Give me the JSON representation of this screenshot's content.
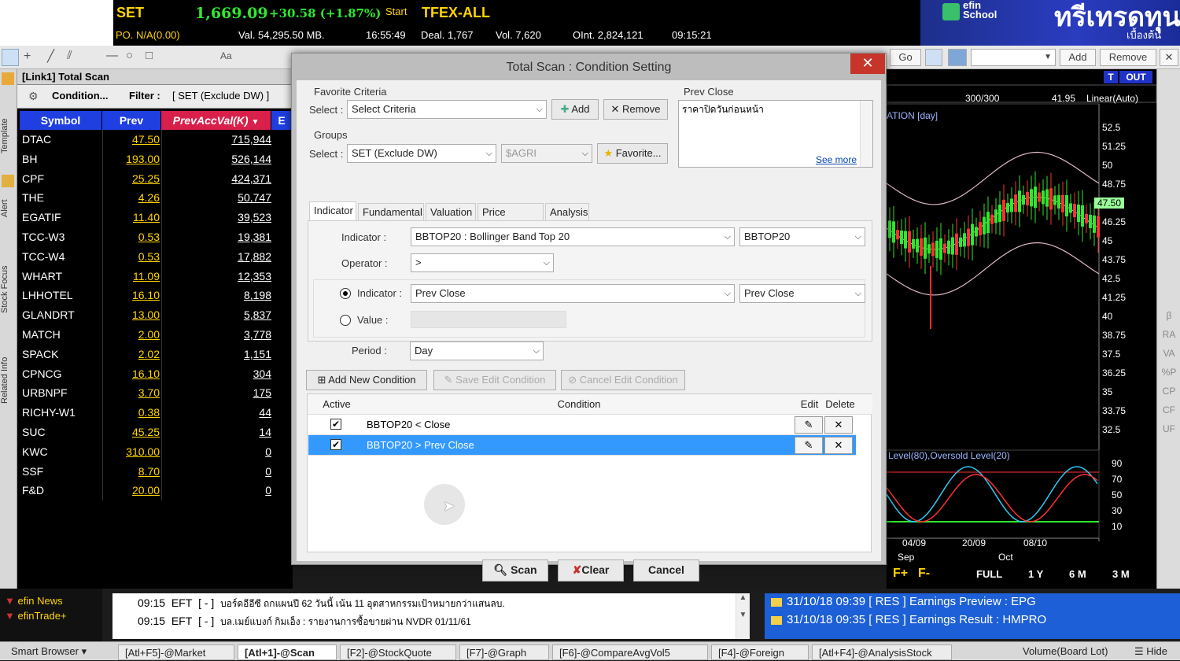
{
  "ticker": {
    "set_label": "SET",
    "set_value": "1,669.09",
    "set_change": "+30.58 (+1.87%)",
    "start_label": "Start",
    "tfex_label": "TFEX-ALL",
    "po_label": "PO. N/A(0.00)",
    "val_label": "Val. 54,295.50 MB.",
    "time1": "16:55:49",
    "deal_label": "Deal. 1,767",
    "vol_label": "Vol. 7,620",
    "oint_label": "OInt. 2,824,121",
    "time2": "09:15:21"
  },
  "banner": {
    "efin_label": "efin School",
    "title": "ทรีเทรดทุน",
    "subtitle": "เบื้องต้น"
  },
  "toolbar": {
    "go_label": "Go",
    "add_label": "Add",
    "remove_label": "Remove"
  },
  "left_tabs": [
    "Template",
    "Alert",
    "Stock Focus",
    "Related Info"
  ],
  "scan_panel": {
    "title": "[Link1] Total Scan",
    "condition_label": "Condition...",
    "filter_label": "Filter :",
    "filter_value": "[ SET (Exclude DW) ]",
    "columns": [
      "Symbol",
      "Prev",
      "PrevAccVal(K)"
    ],
    "rows": [
      {
        "symbol": "DTAC",
        "prev": "47.50",
        "val": "715,944"
      },
      {
        "symbol": "BH",
        "prev": "193.00",
        "val": "526,144"
      },
      {
        "symbol": "CPF",
        "prev": "25.25",
        "val": "424,371"
      },
      {
        "symbol": "THE",
        "prev": "4.26",
        "val": "50,747"
      },
      {
        "symbol": "EGATIF",
        "prev": "11.40",
        "val": "39,523"
      },
      {
        "symbol": "TCC-W3",
        "prev": "0.53",
        "val": "19,381"
      },
      {
        "symbol": "TCC-W4",
        "prev": "0.53",
        "val": "17,882"
      },
      {
        "symbol": "WHART",
        "prev": "11.09",
        "val": "12,353"
      },
      {
        "symbol": "LHHOTEL",
        "prev": "16.10",
        "val": "8,198"
      },
      {
        "symbol": "GLANDRT",
        "prev": "13.00",
        "val": "5,837"
      },
      {
        "symbol": "MATCH",
        "prev": "2.00",
        "val": "3,778"
      },
      {
        "symbol": "SPACK",
        "prev": "2.02",
        "val": "1,151"
      },
      {
        "symbol": "CPNCG",
        "prev": "16.10",
        "val": "304"
      },
      {
        "symbol": "URBNPF",
        "prev": "3.70",
        "val": "175"
      },
      {
        "symbol": "RICHY-W1",
        "prev": "0.38",
        "val": "44"
      },
      {
        "symbol": "SUC",
        "prev": "45.25",
        "val": "14"
      },
      {
        "symbol": "KWC",
        "prev": "310.00",
        "val": "0"
      },
      {
        "symbol": "SSF",
        "prev": "8.70",
        "val": "0"
      },
      {
        "symbol": "F&D",
        "prev": "20.00",
        "val": "0"
      }
    ]
  },
  "dialog": {
    "title": "Total Scan : Condition Setting",
    "favorite_criteria_label": "Favorite Criteria",
    "select_label": "Select :",
    "select_criteria_value": "Select Criteria",
    "add_label": "Add",
    "remove_label": "Remove",
    "groups_label": "Groups",
    "group_value": "SET (Exclude DW)",
    "group_sub_value": "$AGRI",
    "favorite_label": "Favorite...",
    "prev_close_label": "Prev Close",
    "prev_close_text": "ราคาปิดวันก่อนหน้า",
    "see_more_label": "See more",
    "tabs": [
      "Indicator",
      "Fundamental",
      "Valuation",
      "Price Pattern",
      "Analysis"
    ],
    "indicator_label": "Indicator :",
    "indicator_value": "BBTOP20 : Bollinger Band  Top 20",
    "indicator_short": "BBTOP20",
    "operator_label": "Operator :",
    "operator_value": ">",
    "indicator2_label": "Indicator :",
    "indicator2_value": "Prev Close",
    "indicator2_short": "Prev Close",
    "value_label": "Value :",
    "period_label": "Period :",
    "period_value": "Day",
    "add_condition_label": "Add New Condition",
    "save_condition_label": "Save Edit Condition",
    "cancel_condition_label": "Cancel Edit Condition",
    "table_headers": {
      "active": "Active",
      "condition": "Condition",
      "edit": "Edit",
      "delete": "Delete"
    },
    "conditions": [
      {
        "text": "BBTOP20 < Close",
        "active": "✔"
      },
      {
        "text": "BBTOP20 > Prev Close",
        "active": "✔"
      }
    ],
    "scan_label": "Scan",
    "clear_label": "Clear",
    "cancel_label": "Cancel"
  },
  "chart": {
    "t_label": "T",
    "out_label": "OUT",
    "count_label": "300/300",
    "last_value": "41.95",
    "scale_label": "Linear(Auto)",
    "indicator_title": "ATION [day]",
    "price_ticks": [
      "52.5",
      "51.25",
      "50",
      "48.75",
      "47.50",
      "46.25",
      "45",
      "43.75",
      "42.5",
      "41.25",
      "40",
      "38.75",
      "37.5",
      "36.25",
      "35",
      "33.75",
      "32.5"
    ],
    "osc_title": "Level(80),Oversold Level(20)",
    "osc_ticks": [
      "90",
      "70",
      "50",
      "30",
      "10"
    ],
    "date_labels": [
      "04/09",
      "20/09",
      "08/10"
    ],
    "month_labels": [
      "Sep",
      "Oct"
    ],
    "period_buttons": [
      "FULL",
      "1 Y",
      "6 M",
      "3 M"
    ],
    "right_icons": [
      "β",
      "RA",
      "VA",
      "%P",
      "CP",
      "CF",
      "UF"
    ]
  },
  "news": {
    "left_items": [
      "efin News",
      "efinTrade+"
    ],
    "lines": [
      {
        "time": "09:15",
        "src": "EFT",
        "tag": "[ - ]",
        "text": "บอร์ดอีอีซี ถกแผนปี 62 วันนี้ เน้น 11 อุตสาหกรรมเป้าหมายกว่าแสนลบ."
      },
      {
        "time": "09:15",
        "src": "EFT",
        "tag": "[ - ]",
        "text": "บล.เมย์แบงก์ กิมเอ็ง : รายงานการซื้อขายผ่าน NVDR 01/11/61"
      }
    ],
    "right_lines": [
      "31/10/18 09:39 [ RES ] Earnings Preview : EPG",
      "31/10/18 09:35 [ RES ] Earnings Result : HMPRO"
    ]
  },
  "statusbar": {
    "smart_browser": "Smart Browser",
    "tabs": [
      "[Atl+F5]-@Market",
      "[Atl+1]-@Scan",
      "[F2]-@StockQuote",
      "[F7]-@Graph",
      "[F6]-@CompareAvgVol5",
      "[F4]-@Foreign",
      "[Atl+F4]-@AnalysisStock"
    ],
    "volume_label": "Volume(Board Lot)",
    "hide_label": "Hide"
  },
  "colors": {
    "header_blue": "#1f3fe0",
    "sel_blue": "#3399ff",
    "up_green": "#2ee82e",
    "ticker_yellow": "#ffd400",
    "close_red": "#c7352a"
  }
}
